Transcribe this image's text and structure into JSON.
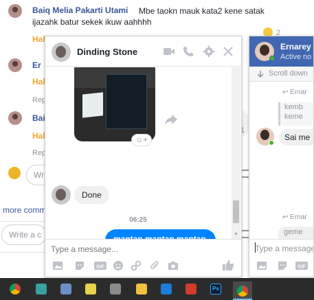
{
  "feed": {
    "comment1": {
      "name": "Baiq Melia Pakarti Utami",
      "text_line1": "Mbe taokn mauk kata2 kene satak",
      "text_line2": "ijazahk batur sekek ikuw aahhhh",
      "meta": "Hah",
      "reaction_count": "2",
      "reaction_icon": "laughing-emoji-icon"
    },
    "comment2": {
      "name": "Er",
      "meta": "Hah",
      "reply": "Rep"
    },
    "comment3": {
      "name": "Bai",
      "meta": "Hah",
      "reply": "Rep",
      "count": "1"
    },
    "reply_input_placeholder": "Wri",
    "more_comments": "more comm",
    "write_comment_placeholder": "Write a c"
  },
  "chat": {
    "contact_name": "Dinding Stone",
    "header_icons": [
      "video-call-icon",
      "phone-call-icon",
      "settings-icon",
      "close-icon"
    ],
    "react_label": "☺+",
    "incoming_message": "Done",
    "timestamp": "06:25",
    "outgoing_message": "mantap mantap mantap paman",
    "input_placeholder": "Type a message...",
    "toolbar_icons": [
      "photo-icon",
      "sticker-icon",
      "gif-icon",
      "emoji-icon",
      "link-icon",
      "attachment-icon",
      "camera-icon",
      "thumbs-up-icon"
    ]
  },
  "right_chat": {
    "contact_name": "Ernarey",
    "status": "Active no",
    "scroll_down": "Scroll down",
    "reply_label_1": "↩ Ernar",
    "quote_line1": "kemb",
    "quote_line2": "keme",
    "message": "Sai me",
    "reply_label_2": "↩ Ernar",
    "quote2": "geme",
    "input_placeholder": "Type a message"
  },
  "taskbar": {
    "apps": [
      "chrome-icon",
      "app-icon",
      "store-icon",
      "media-icon",
      "files-icon",
      "vscode-icon",
      "filezilla-icon",
      "app2-icon",
      "photoshop-icon",
      "chrome-active-icon"
    ],
    "ps_label": "Ps"
  },
  "colors": {
    "brand": "#4267b2",
    "link": "#385898",
    "outgoing_bubble": "#0084ff",
    "online": "#42b72a"
  }
}
